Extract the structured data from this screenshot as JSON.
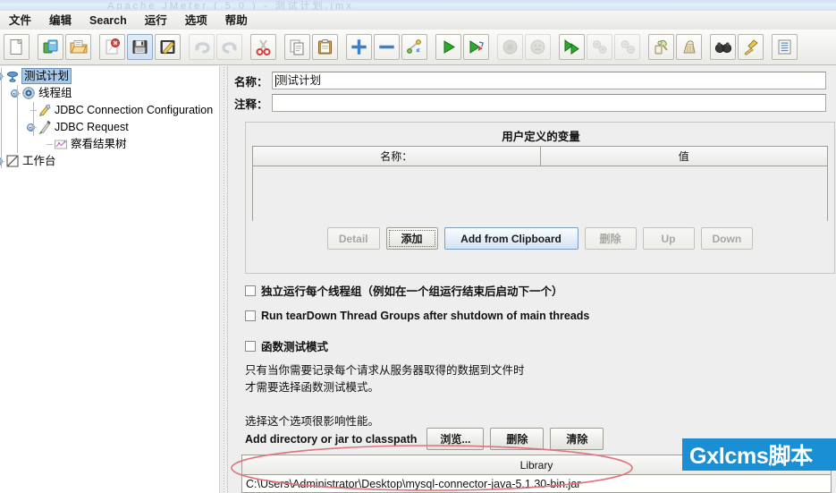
{
  "window": {
    "title_faint": "Apache JMeter  ( 5.0 )  -  测试计划.jmx"
  },
  "menubar": {
    "items": [
      {
        "label": "文件",
        "name": "menu-file"
      },
      {
        "label": "编辑",
        "name": "menu-edit"
      },
      {
        "label": "Search",
        "name": "menu-search"
      },
      {
        "label": "运行",
        "name": "menu-run"
      },
      {
        "label": "选项",
        "name": "menu-options"
      },
      {
        "label": "帮助",
        "name": "menu-help"
      }
    ]
  },
  "toolbar": {
    "buttons": [
      {
        "name": "new-icon",
        "icon": "new",
        "state": "framed"
      },
      {
        "name": "templates-icon",
        "icon": "templates",
        "state": "framed"
      },
      {
        "name": "open-icon",
        "icon": "open",
        "state": "framed"
      },
      {
        "name": "close-icon",
        "icon": "close",
        "state": "framed"
      },
      {
        "name": "save-icon",
        "icon": "save",
        "state": "pressed"
      },
      {
        "name": "save-as-icon",
        "icon": "saveas",
        "state": "framed"
      },
      {
        "name": "undo-icon",
        "icon": "undo",
        "state": "disabled"
      },
      {
        "name": "redo-icon",
        "icon": "redo",
        "state": "disabled"
      },
      {
        "name": "cut-icon",
        "icon": "cut",
        "state": "framed"
      },
      {
        "name": "copy-icon",
        "icon": "copy",
        "state": "framed"
      },
      {
        "name": "paste-icon",
        "icon": "paste",
        "state": "framed"
      },
      {
        "name": "expand-all-icon",
        "icon": "plus",
        "state": "framed"
      },
      {
        "name": "collapse-all-icon",
        "icon": "minus",
        "state": "framed"
      },
      {
        "name": "toggle-icon",
        "icon": "toggle",
        "state": "framed"
      },
      {
        "name": "start-icon",
        "icon": "start",
        "state": "framed"
      },
      {
        "name": "start-no-pauses-icon",
        "icon": "startnp",
        "state": "framed"
      },
      {
        "name": "stop-icon",
        "icon": "stop",
        "state": "disabled"
      },
      {
        "name": "shutdown-icon",
        "icon": "shutdown",
        "state": "disabled"
      },
      {
        "name": "remote-start-all-icon",
        "icon": "remotestart",
        "state": "framed"
      },
      {
        "name": "remote-stop-all-icon",
        "icon": "remotestop",
        "state": "disabled"
      },
      {
        "name": "remote-shutdown-all-icon",
        "icon": "remoteshut",
        "state": "disabled"
      },
      {
        "name": "clear-icon",
        "icon": "clear",
        "state": "framed"
      },
      {
        "name": "clear-all-icon",
        "icon": "clearall",
        "state": "framed"
      },
      {
        "name": "search-icon",
        "icon": "binoculars",
        "state": "framed"
      },
      {
        "name": "search-reset-icon",
        "icon": "broom",
        "state": "framed"
      },
      {
        "name": "function-helper-icon",
        "icon": "functions",
        "state": "framed"
      }
    ]
  },
  "tree": {
    "nodes": [
      {
        "label": "测试计划",
        "icon": "test-plan-icon",
        "depth": 0,
        "selected": true
      },
      {
        "label": "线程组",
        "icon": "thread-group-icon",
        "depth": 1,
        "selected": false
      },
      {
        "label": "JDBC Connection Configuration",
        "icon": "config-icon",
        "depth": 2,
        "selected": false
      },
      {
        "label": "JDBC Request",
        "icon": "sampler-icon",
        "depth": 2,
        "selected": false
      },
      {
        "label": "察看结果树",
        "icon": "listener-icon",
        "depth": 3,
        "selected": false
      },
      {
        "label": "工作台",
        "icon": "workbench-icon",
        "depth": 0,
        "selected": false
      }
    ]
  },
  "form": {
    "name_label": "名称：",
    "name_value": "测试计划",
    "comment_label": "注释：",
    "comment_value": "",
    "udv_title": "用户定义的变量",
    "udv_columns": [
      "名称：",
      "值"
    ],
    "udv_rows": [],
    "udv_buttons": [
      {
        "label": "Detail",
        "name": "detail-button",
        "state": "disabled"
      },
      {
        "label": "添加",
        "name": "add-button",
        "state": "focusring"
      },
      {
        "label": "Add from Clipboard",
        "name": "add-from-clipboard-button",
        "state": "default"
      },
      {
        "label": "删除",
        "name": "delete-button",
        "state": "disabled"
      },
      {
        "label": "Up",
        "name": "up-button",
        "state": "disabled"
      },
      {
        "label": "Down",
        "name": "down-button",
        "state": "disabled"
      }
    ],
    "checkboxes": [
      {
        "label": "独立运行每个线程组（例如在一个组运行结束后启动下一个）",
        "name": "checkbox-serialize-thread-groups",
        "checked": false
      },
      {
        "label": "Run tearDown Thread Groups after shutdown of main threads",
        "name": "checkbox-run-teardown",
        "checked": false
      },
      {
        "label": "函数测试模式",
        "name": "checkbox-functional-test-mode",
        "checked": false
      }
    ],
    "help_lines": [
      "只有当你需要记录每个请求从服务器取得的数据到文件时",
      "才需要选择函数测试模式。",
      "",
      "选择这个选项很影响性能。"
    ],
    "classpath_label": "Add directory or jar to classpath",
    "classpath_buttons": [
      {
        "label": "浏览...",
        "name": "browse-button"
      },
      {
        "label": "删除",
        "name": "classpath-delete-button"
      },
      {
        "label": "清除",
        "name": "classpath-clear-button"
      }
    ],
    "library_column": "Library",
    "library_rows": [
      "C:\\Users\\Administrator\\Desktop\\mysql-connector-java-5.1.30-bin.jar"
    ]
  },
  "annotation": {
    "color": "#e0747c",
    "shape": "ellipse"
  },
  "watermark": {
    "text": "Gxlcms脚本",
    "background": "#1a8fd4",
    "color": "#ffffff"
  },
  "colors": {
    "panel_bg": "#eeeeee",
    "tree_bg": "#ffffff",
    "selection": "#a8c8e8",
    "field_bg": "#ffffff",
    "border": "#9e9e98"
  }
}
